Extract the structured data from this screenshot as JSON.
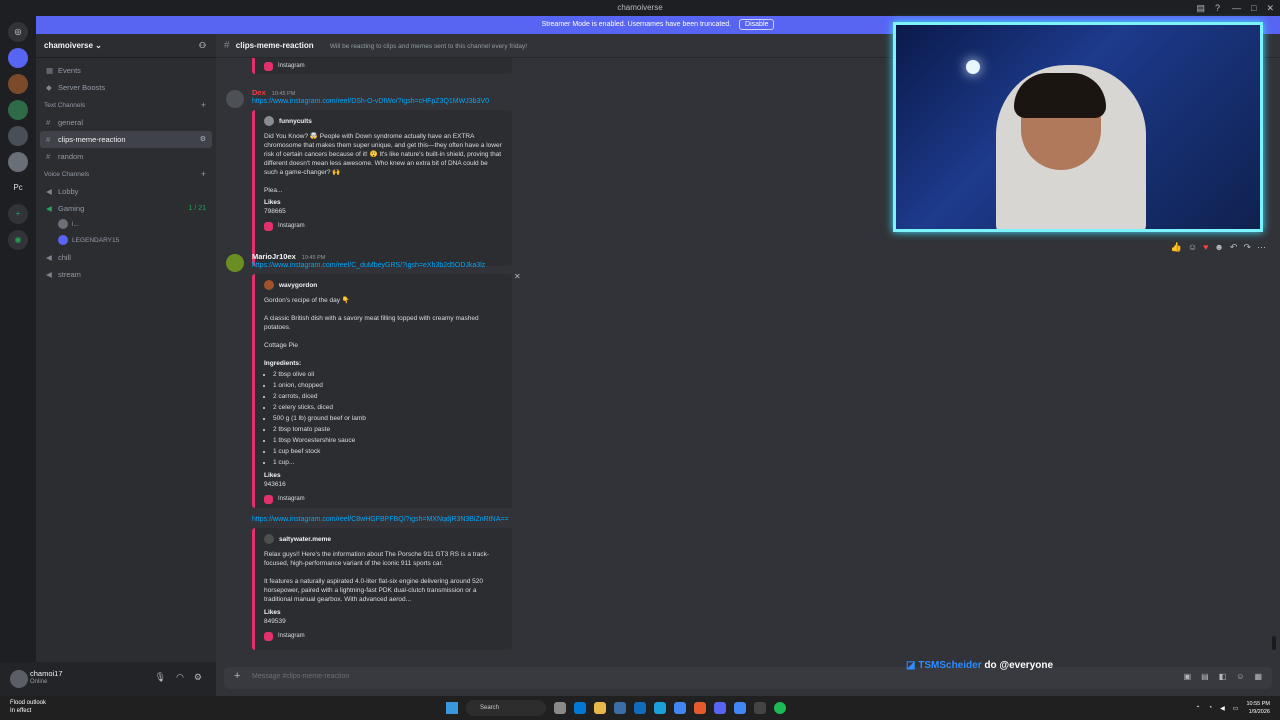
{
  "app_title": "chamoiverse",
  "banner": {
    "text": "Streamer Mode is enabled. Usernames have been truncated.",
    "button": "Disable"
  },
  "server_rail": [
    "Pc"
  ],
  "server": {
    "name": "chamoiverse",
    "top_items": [
      {
        "icon": "calendar-icon",
        "label": "Events"
      },
      {
        "icon": "boost-icon",
        "label": "Server Boosts"
      }
    ],
    "text_category": "Text Channels",
    "text_channels": [
      "general",
      "clips-meme-reaction",
      "random"
    ],
    "voice_category": "Voice Channels",
    "voice_channels": [
      {
        "name": "Lobby",
        "count": ""
      },
      {
        "name": "Gaming",
        "count": "1 / 21"
      }
    ],
    "gaming_users": [
      "l...",
      "LEGENDARY15"
    ],
    "extra_voice": [
      "chill",
      "stream"
    ]
  },
  "user": {
    "name": "chamoi17",
    "status": "Online"
  },
  "channel": {
    "name": "clips-meme-reaction",
    "topic": "Will be reacting to clips and memes sent to this channel every friday!"
  },
  "messages": {
    "top_embed_provider": "Instagram",
    "m1": {
      "author": "Dex",
      "time": "10:45 PM",
      "link": "https://www.instagram.com/reel/DSh-O-vDIWo/?igsh=cHFpZ3Q1MWJ3b3V0",
      "embed_author": "funnycults",
      "text": "Did You Know? 🤯 People with Down syndrome actually have an EXTRA chromosome that makes them super unique, and get this—they often have a lower risk of certain cancers because of it! 😲 It's like nature's built-in shield, proving that different doesn't mean less awesome. Who knew an extra bit of DNA could be such a game-changer? 🙌",
      "more": "Plea...",
      "likes_label": "Likes",
      "likes": "798665",
      "provider": "Instagram"
    },
    "m2": {
      "author": "MarioJr10ex",
      "time": "10:45 PM",
      "link": "https://www.instagram.com/reel/C_duMbeyGRS/?igsh=eXh3b2d5ODJka3lz",
      "embed_author": "wavygordon",
      "title": "Gordon's recipe of the day 👇",
      "desc": "A classic British dish with a savory meat filling topped with creamy mashed potatoes.",
      "dish": "Cottage Pie",
      "ingredients_label": "Ingredients:",
      "ingredients": [
        "2 tbsp olive oil",
        "1 onion, chopped",
        "2 carrots, diced",
        "2 celery sticks, diced",
        "500 g (1 lb) ground beef or lamb",
        "2 tbsp tomato paste",
        "1 tbsp Worcestershire sauce",
        "1 cup beef stock",
        "1 cup..."
      ],
      "likes_label": "Likes",
      "likes": "943616",
      "provider": "Instagram"
    },
    "m3": {
      "link": "https://www.instagram.com/reel/C8wHGFBPFBQ/?igsh=MXNqdjR3N3BiZnRtNA==",
      "embed_author": "saltywater.meme",
      "p1": "Relax guys!! Here's the information about The Porsche 911 GT3 RS is a track-focused, high-performance variant of the iconic 911 sports car.",
      "p2": "It features a naturally aspirated 4.0-liter flat-six engine delivering around 520 horsepower, paired with a lightning-fast PDK dual-clutch transmission or a traditional manual gearbox. With advanced aerod...",
      "likes_label": "Likes",
      "likes": "849539",
      "provider": "Instagram"
    }
  },
  "composer": {
    "placeholder": "Message #clips-meme-reaction"
  },
  "overlay": {
    "twitch_user": "TSMScheider",
    "message": "do @everyone"
  },
  "taskbar": {
    "weather_line1": "Flood outlook",
    "weather_line2": "In effect",
    "search": "Search",
    "time": "10:55 PM",
    "date": "1/9/2026"
  },
  "colors": {
    "accent": "#5865f2",
    "instagram": "#e1306c",
    "link": "#00a8fc",
    "cam_border": "#7cf4ff"
  }
}
